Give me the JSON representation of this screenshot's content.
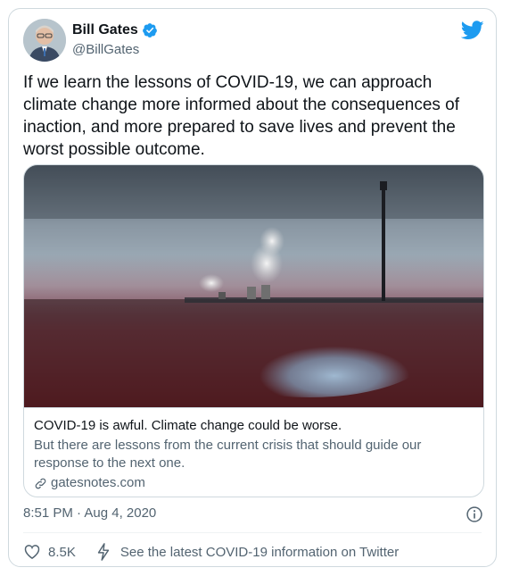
{
  "author": {
    "name": "Bill Gates",
    "handle": "@BillGates",
    "verified": true
  },
  "tweet": {
    "text": "If we learn the lessons of COVID-19, we can approach climate change more informed about the consequences of inaction, and more prepared to save lives and prevent the worst possible outcome."
  },
  "link_card": {
    "title": "COVID-19 is awful. Climate change could be worse.",
    "description": "But there are lessons from the current crisis that should guide our response to the next one.",
    "domain": "gatesnotes.com"
  },
  "meta": {
    "timestamp": "8:51 PM · Aug 4, 2020"
  },
  "actions": {
    "likes": "8.5K",
    "covid_info": "See the latest COVID-19 information on Twitter"
  },
  "colors": {
    "brand": "#1d9bf0",
    "text": "#0f1419",
    "secondary": "#536471",
    "border": "#cfd9de"
  }
}
